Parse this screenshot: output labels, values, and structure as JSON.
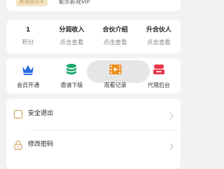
{
  "membership": {
    "badge_text": "影视会员卡",
    "description": "能乐影视VIP"
  },
  "stats": [
    {
      "value": "1",
      "label": "积分"
    },
    {
      "value": "分润收入",
      "label": "点击查看"
    },
    {
      "value": "合伙介绍",
      "label": "点击查看"
    },
    {
      "value": "升合伙人",
      "label": "点击查看"
    }
  ],
  "actions": [
    {
      "label": "会员开通",
      "icon": "crown-icon",
      "color": "#2b6de0"
    },
    {
      "label": "邀请下级",
      "icon": "stack-icon",
      "color": "#1aa66a"
    },
    {
      "label": "观看记录",
      "icon": "film-icon",
      "color": "#f08c1d"
    },
    {
      "label": "代理后台",
      "icon": "agent-icon",
      "color": "#e8364a"
    }
  ],
  "settings": [
    {
      "label": "安全退出",
      "icon": "exit-icon"
    },
    {
      "label": "修改密码",
      "icon": "lock-icon"
    }
  ],
  "colors": {
    "background": "#f2f2f4",
    "card": "#ffffff",
    "badge_bg": "#f3e3c1",
    "badge_text": "#b9955a"
  }
}
